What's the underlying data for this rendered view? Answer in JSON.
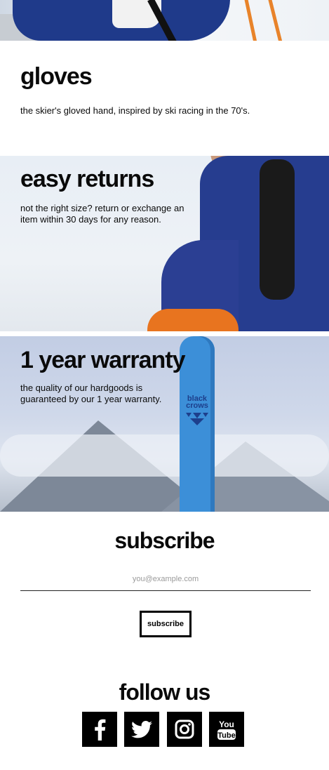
{
  "sections": {
    "gloves": {
      "title": "gloves",
      "text": "the skier's gloved hand, inspired by ski racing in the 70's."
    },
    "returns": {
      "title": "easy returns",
      "text": "not the right size? return or exchange an item within 30 days for any reason."
    },
    "warranty": {
      "title": "1 year warranty",
      "text": "the quality of our hardgoods is guaranteed by our 1 year warranty.",
      "ski_brand": "black crows"
    }
  },
  "subscribe": {
    "title": "subscribe",
    "placeholder": "you@example.com",
    "button_label": "subscribe"
  },
  "follow": {
    "title": "follow us",
    "networks": [
      {
        "name": "facebook",
        "icon": "facebook-icon"
      },
      {
        "name": "twitter",
        "icon": "twitter-icon"
      },
      {
        "name": "instagram",
        "icon": "instagram-icon"
      },
      {
        "name": "youtube",
        "icon": "youtube-icon",
        "text_top": "You",
        "text_bottom": "Tube"
      }
    ]
  },
  "colors": {
    "text": "#0a0a0a",
    "jacket_blue": "#263d8f",
    "ski_blue": "#3c8fd8",
    "accent_orange": "#e8741f"
  }
}
